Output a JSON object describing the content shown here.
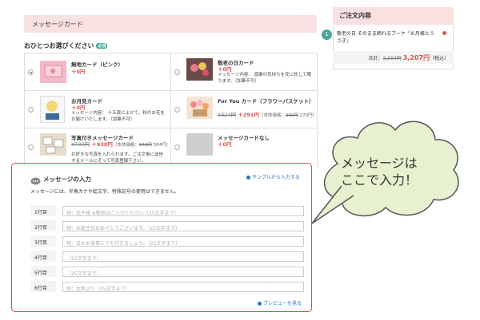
{
  "section_title": "メッセージカード",
  "choose_label": "おひとつお選びください",
  "required_badge": "必須",
  "cards": [
    {
      "name": "無地カード（ピンク）",
      "price": "＋0円",
      "desc": "",
      "selected": true
    },
    {
      "name": "敬老の日カード",
      "price": "＋0円",
      "desc": "メッセージ内容： 感謝の気持ちを花に託して贈ります。（加筆不可）"
    },
    {
      "name": "お月見カード",
      "price": "＋0円",
      "desc": "メッセージ内容： 十五夜によせて、秋のお花をお届けいたします。（加筆不可）"
    },
    {
      "name": "For You カード（フラワーバスケット）",
      "price_old": "¥324円",
      "price": "＋291円",
      "extra_pre": "（本体価格：",
      "extra_old": "300円",
      "extra_post": " 270円）"
    },
    {
      "name": "写真付きメッセージカード",
      "price_old": "¥700円",
      "price": "＋630円",
      "extra_pre": "（本体価格：",
      "extra_old": "648円",
      "extra_post": " 584円）",
      "desc": "お好きな写真を入れられます。ご注文後に送信するメールにそって写真登録下さい。"
    },
    {
      "name": "メッセージカードなし",
      "price": "＋0円"
    }
  ],
  "message": {
    "title": "メッセージの入力",
    "sample_link": "サンプルから入力する",
    "note": "メッセージには、半角カナや絵文字、特殊記号の使用はできません。",
    "rows": [
      {
        "label": "1行目",
        "placeholder": "例：花子様 ※敬称はご入力ください（25文字まで）"
      },
      {
        "label": "2行目",
        "placeholder": "例：お誕生日おめでとうございます。（25文字まで）"
      },
      {
        "label": "3行目",
        "placeholder": "例：またお食事にでも行きましょう。（25文字まで）"
      },
      {
        "label": "4行目",
        "placeholder": "（25文字まで）"
      },
      {
        "label": "5行目",
        "placeholder": "（25文字まで）"
      },
      {
        "label": "6行目",
        "placeholder": "例：太郎より（25文字まで）"
      }
    ],
    "preview_link": "プレビューを見る"
  },
  "order": {
    "title": "ご注文内容",
    "item_number": "1",
    "item": "敬老の日 そのまま飾れるブーケ「お月様とうさぎ」",
    "total_label": "合計：",
    "total_old": "3,564円",
    "total_new": "3,207円",
    "tax_note": "（税込）"
  },
  "callout": "メッセージは\nここで入力！",
  "colors": {
    "accent_pink": "#fae1e1",
    "price_red": "#d9534f",
    "bubble_green": "#e6f2cf",
    "link_blue": "#2f72c9",
    "highlight_red": "#e0444b"
  }
}
